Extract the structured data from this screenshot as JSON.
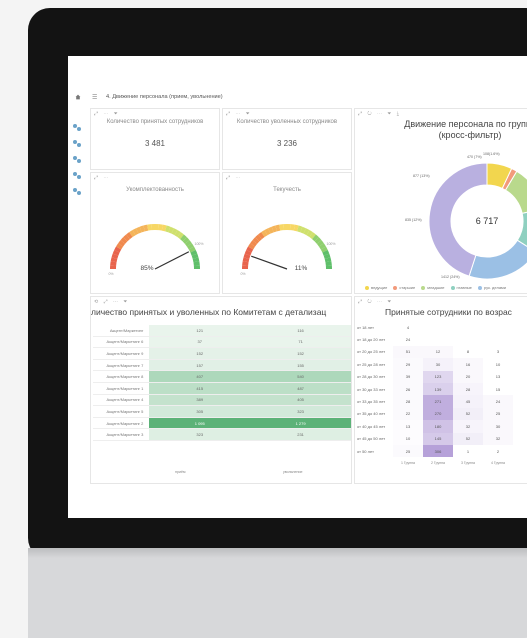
{
  "breadcrumb": {
    "title": "4. Движение персонала (прием, увольнение)"
  },
  "kpi": [
    {
      "label": "Количество принятых сотрудников",
      "value": "3 481"
    },
    {
      "label": "Количество уволенных сотрудников",
      "value": "3 236"
    }
  ],
  "gauges": [
    {
      "label": "Укомплектованность",
      "value_text": "85%",
      "value": 0.85,
      "scale_min": "0%",
      "scale_max": "100%"
    },
    {
      "label": "Текучесть",
      "value_text": "11%",
      "value": 0.11,
      "scale_min": "0%",
      "scale_max": "100%"
    }
  ],
  "donut": {
    "title_line1": "Движение персонала по группе",
    "title_line2": "(кросс-фильтр)",
    "center_value": "6 717",
    "labels": [
      "470 (7%)",
      "108(1.6%)",
      "877 (13%)",
      "835 (12%)",
      "1412 (24%)"
    ],
    "segments": [
      {
        "name": "ведущие",
        "share": 0.07,
        "color": "#f2d64e"
      },
      {
        "name": "старшие",
        "share": 0.016,
        "color": "#f29a7b"
      },
      {
        "name": "младшие",
        "share": 0.13,
        "color": "#b9d98c"
      },
      {
        "name": "главные",
        "share": 0.124,
        "color": "#8fd0c0"
      },
      {
        "name": "рук. делами",
        "share": 0.21,
        "color": "#9bc0e5"
      },
      {
        "name": "прочие",
        "share": 0.45,
        "color": "#b9b0e0"
      }
    ],
    "legend": [
      "ведущие",
      "старшие",
      "младшие",
      "главные",
      "рук. делами"
    ]
  },
  "table_committees": {
    "title": "личество принятых и уволенных по Комитетам с детализац",
    "rows": [
      {
        "name": "Акцент/Маркетинг",
        "hired": "121",
        "fired": "116",
        "level": 0.05
      },
      {
        "name": "Акцент/Маркетинг 6",
        "hired": "37",
        "fired": "71",
        "level": 0.05
      },
      {
        "name": "Акцент/Маркетинг 9",
        "hired": "152",
        "fired": "152",
        "level": 0.08
      },
      {
        "name": "Акцент/Маркетинг 7",
        "hired": "157",
        "fired": "155",
        "level": 0.1
      },
      {
        "name": "Акцент/Маркетинг 8",
        "hired": "407",
        "fired": "540",
        "level": 0.45
      },
      {
        "name": "Акцент/Маркетинг 1",
        "hired": "415",
        "fired": "487",
        "level": 0.35
      },
      {
        "name": "Акцент/Маркетинг 4",
        "hired": "389",
        "fired": "405",
        "level": 0.3
      },
      {
        "name": "Акцент/Маркетинг 5",
        "hired": "305",
        "fired": "323",
        "level": 0.2
      },
      {
        "name": "Акцент/Маркетинг 2",
        "hired": "1 095",
        "fired": "1 279",
        "level": 1.0
      },
      {
        "name": "Акцент/Маркетинг 3",
        "hired": "323",
        "fired": "231",
        "level": 0.12
      }
    ],
    "col_labels": [
      "приём",
      "увольнение"
    ]
  },
  "heatmap": {
    "title": "Принятые сотрудники по возрас",
    "rows": [
      {
        "label": "от 18 лет",
        "v": [
          "4",
          "",
          "",
          ""
        ],
        "l": [
          0,
          0,
          0,
          0
        ]
      },
      {
        "label": "от 18 до 20 лет",
        "v": [
          "24",
          "",
          "",
          ""
        ],
        "l": [
          0,
          0,
          0,
          0
        ]
      },
      {
        "label": "от 20 до 25 лет",
        "v": [
          "51",
          "12",
          "8",
          "3"
        ],
        "l": [
          0.05,
          0.05,
          0,
          0
        ]
      },
      {
        "label": "от 25 до 28 лет",
        "v": [
          "29",
          "30",
          "16",
          "10"
        ],
        "l": [
          0.04,
          0.1,
          0.05,
          0
        ]
      },
      {
        "label": "от 28 до 30 лет",
        "v": [
          "39",
          "123",
          "20",
          "13"
        ],
        "l": [
          0.04,
          0.3,
          0.05,
          0
        ]
      },
      {
        "label": "от 30 до 33 лет",
        "v": [
          "26",
          "139",
          "28",
          "15"
        ],
        "l": [
          0.04,
          0.35,
          0.08,
          0
        ]
      },
      {
        "label": "от 33 до 35 лет",
        "v": [
          "28",
          "271",
          "45",
          "24"
        ],
        "l": [
          0.04,
          0.6,
          0.1,
          0.05
        ]
      },
      {
        "label": "от 35 до 40 лет",
        "v": [
          "22",
          "270",
          "52",
          "25"
        ],
        "l": [
          0.04,
          0.6,
          0.12,
          0.05
        ]
      },
      {
        "label": "от 40 до 45 лет",
        "v": [
          "13",
          "180",
          "32",
          "30"
        ],
        "l": [
          0.02,
          0.45,
          0.08,
          0.05
        ]
      },
      {
        "label": "от 45 до 50 лет",
        "v": [
          "10",
          "145",
          "52",
          "32"
        ],
        "l": [
          0.02,
          0.4,
          0.12,
          0.05
        ]
      },
      {
        "label": "от 50 лет",
        "v": [
          "25",
          "306",
          "1",
          "2"
        ],
        "l": [
          0.04,
          0.7,
          0,
          0
        ]
      }
    ],
    "cols": [
      "1 Группа",
      "2 Группа",
      "3 Группа",
      "4 Группа"
    ]
  }
}
